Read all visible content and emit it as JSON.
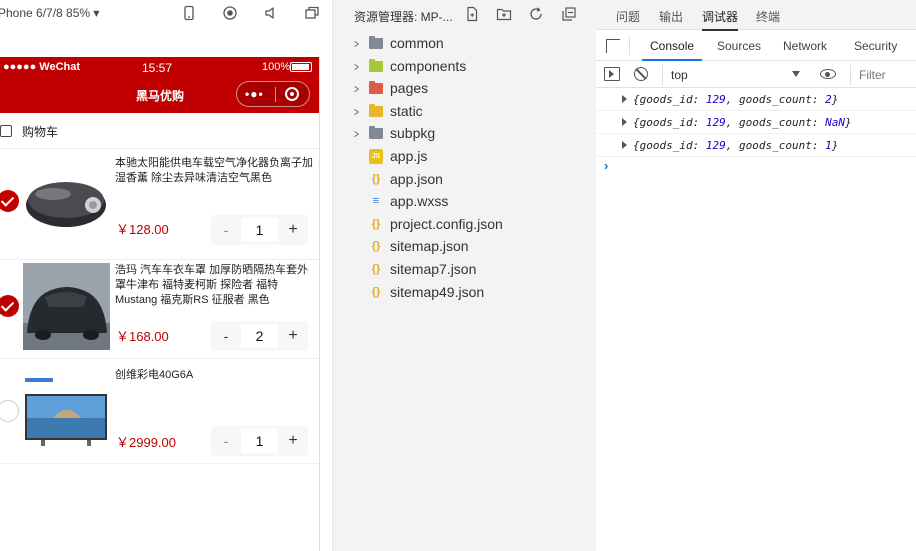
{
  "simulator": {
    "device_label": "Phone 6/7/8 85%",
    "device_arrow": "▾",
    "status": {
      "signal": "●●●●● WeChat",
      "time": "15:57",
      "battery": "100%"
    },
    "nav_title": "黑马优购",
    "capsule_dots": "•●•",
    "cart_title": "购物车",
    "items": [
      {
        "name": "本驰太阳能供电车载空气净化器负离子加湿香薰 除尘去异味清洁空气黑色",
        "price": "￥128.00",
        "count": "1",
        "checked": true
      },
      {
        "name": "浩玛 汽车车衣车罩 加厚防晒隔热车套外罩牛津布 福特麦柯斯 探险者 福特Mustang 福克斯RS 征服者 黑色",
        "price": "￥168.00",
        "count": "2",
        "checked": true
      },
      {
        "name": "创维彩电40G6A",
        "price": "￥2999.00",
        "count": "1",
        "checked": false
      }
    ],
    "stepper": {
      "minus": "-",
      "plus": "+"
    }
  },
  "explorer": {
    "title": "资源管理器: MP-...",
    "tree": [
      {
        "label": "common",
        "type": "folder",
        "color": "#7f8a96"
      },
      {
        "label": "components",
        "type": "folder",
        "color": "#a8c83a"
      },
      {
        "label": "pages",
        "type": "folder",
        "color": "#e05a4a"
      },
      {
        "label": "static",
        "type": "folder",
        "color": "#e8b62c"
      },
      {
        "label": "subpkg",
        "type": "folder",
        "color": "#7f8a96"
      },
      {
        "label": "app.js",
        "type": "file",
        "icon": "JS",
        "color": "#e8c21c"
      },
      {
        "label": "app.json",
        "type": "file",
        "icon": "{}",
        "color": "#e8a81c"
      },
      {
        "label": "app.wxss",
        "type": "file",
        "icon": "≡",
        "color": "#3a7bd5"
      },
      {
        "label": "project.config.json",
        "type": "file",
        "icon": "{}",
        "color": "#e8a81c"
      },
      {
        "label": "sitemap.json",
        "type": "file",
        "icon": "{}",
        "color": "#e8a81c"
      },
      {
        "label": "sitemap7.json",
        "type": "file",
        "icon": "{}",
        "color": "#e8a81c"
      },
      {
        "label": "sitemap49.json",
        "type": "file",
        "icon": "{}",
        "color": "#e8a81c"
      }
    ]
  },
  "devtools": {
    "top_tabs": [
      "问题",
      "输出",
      "调试器",
      "终端"
    ],
    "active_top_tab": "调试器",
    "tabs": [
      "Console",
      "Sources",
      "Network",
      "Security"
    ],
    "active_tab": "Console",
    "context": "top",
    "filter_placeholder": "Filter",
    "logs": [
      {
        "goods_id": "129",
        "goods_count": "2"
      },
      {
        "goods_id": "129",
        "goods_count": "NaN"
      },
      {
        "goods_id": "129",
        "goods_count": "1"
      }
    ],
    "prompt": "›"
  }
}
